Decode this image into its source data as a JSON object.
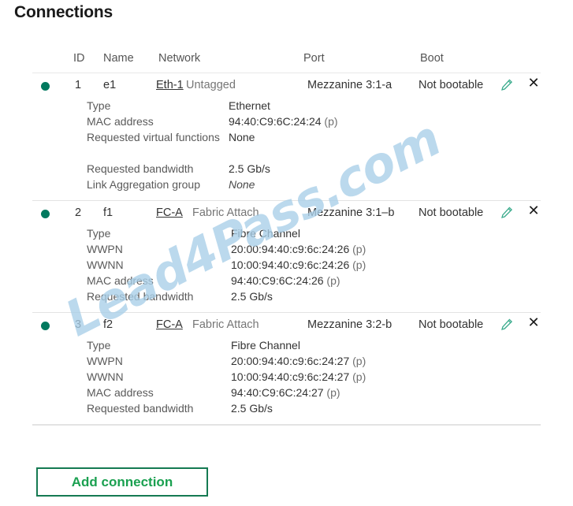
{
  "page": {
    "title": "Connections",
    "watermark": "Lead4Pass.com"
  },
  "table": {
    "columns": {
      "id": "ID",
      "name": "Name",
      "network": "Network",
      "port": "Port",
      "boot": "Boot"
    },
    "icons": {
      "edit": "pencil-icon",
      "delete": "close-icon",
      "status": "status-dot-icon"
    },
    "rows": [
      {
        "status_color": "#00795e",
        "id": "1",
        "name": "e1",
        "network_link": "Eth-1",
        "network_tag": "Untagged",
        "port": "Mezzanine 3:1-a",
        "boot": "Not bootable",
        "details": [
          {
            "label": "Type",
            "value": "Ethernet",
            "suffix": ""
          },
          {
            "label": "MAC address",
            "value": "94:40:C9:6C:24:24",
            "suffix": " (p)"
          },
          {
            "label": "Requested virtual functions",
            "value": "None",
            "suffix": ""
          },
          {
            "label": "Requested bandwidth",
            "value": "2.5 Gb/s",
            "suffix": ""
          },
          {
            "label": "Link Aggregation group",
            "value": "None",
            "suffix": "",
            "italic": true
          }
        ]
      },
      {
        "status_color": "#00795e",
        "id": "2",
        "name": "f1",
        "network_link": "FC-A",
        "network_tag": "Fabric Attach",
        "port": "Mezzanine 3:1–b",
        "boot": "Not bootable",
        "details": [
          {
            "label": "Type",
            "value": "Fibre Channel",
            "suffix": ""
          },
          {
            "label": "WWPN",
            "value": "20:00:94:40:c9:6c:24:26",
            "suffix": " (p)"
          },
          {
            "label": "WWNN",
            "value": "10:00:94:40:c9:6c:24:26",
            "suffix": " (p)"
          },
          {
            "label": "MAC address",
            "value": "94:40:C9:6C:24:26",
            "suffix": " (p)"
          },
          {
            "label": "Requested bandwidth",
            "value": "2.5 Gb/s",
            "suffix": ""
          }
        ]
      },
      {
        "status_color": "#00795e",
        "id": "3",
        "name": "f2",
        "network_link": "FC-A",
        "network_tag": "Fabric Attach",
        "port": "Mezzanine 3:2-b",
        "boot": "Not bootable",
        "details": [
          {
            "label": "Type",
            "value": "Fibre Channel",
            "suffix": ""
          },
          {
            "label": "WWPN",
            "value": "20:00:94:40:c9:6c:24:27",
            "suffix": " (p)"
          },
          {
            "label": "WWNN",
            "value": "10:00:94:40:c9:6c:24:27",
            "suffix": " (p)"
          },
          {
            "label": "MAC address",
            "value": "94:40:C9:6C:24:27",
            "suffix": " (p)"
          },
          {
            "label": "Requested bandwidth",
            "value": "2.5 Gb/s",
            "suffix": ""
          }
        ]
      }
    ]
  },
  "footer": {
    "add_button_label": "Add connection",
    "add_button_color": "#1aa050"
  }
}
